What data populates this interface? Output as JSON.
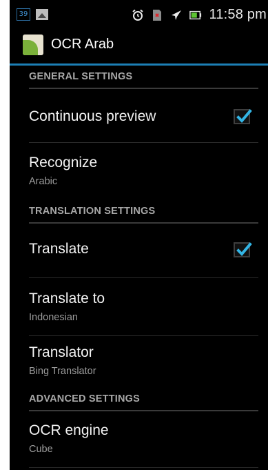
{
  "status_bar": {
    "notification_count": "39",
    "time": "11:58 pm",
    "icons": [
      "alarm-icon",
      "no-sim-icon",
      "airplane-icon",
      "battery-icon"
    ]
  },
  "action_bar": {
    "title": "OCR Arab"
  },
  "settings": {
    "general": {
      "header": "GENERAL SETTINGS",
      "continuous_preview": {
        "title": "Continuous preview",
        "checked": true
      },
      "recognize": {
        "title": "Recognize",
        "summary": "Arabic"
      }
    },
    "translation": {
      "header": "TRANSLATION SETTINGS",
      "translate": {
        "title": "Translate",
        "checked": true
      },
      "translate_to": {
        "title": "Translate to",
        "summary": "Indonesian"
      },
      "translator": {
        "title": "Translator",
        "summary": "Bing Translator"
      }
    },
    "advanced": {
      "header": "ADVANCED SETTINGS",
      "ocr_engine": {
        "title": "OCR engine",
        "summary": "Cube"
      }
    }
  },
  "colors": {
    "accent": "#1c7fb5",
    "check": "#33b5e5",
    "background": "#000000"
  }
}
